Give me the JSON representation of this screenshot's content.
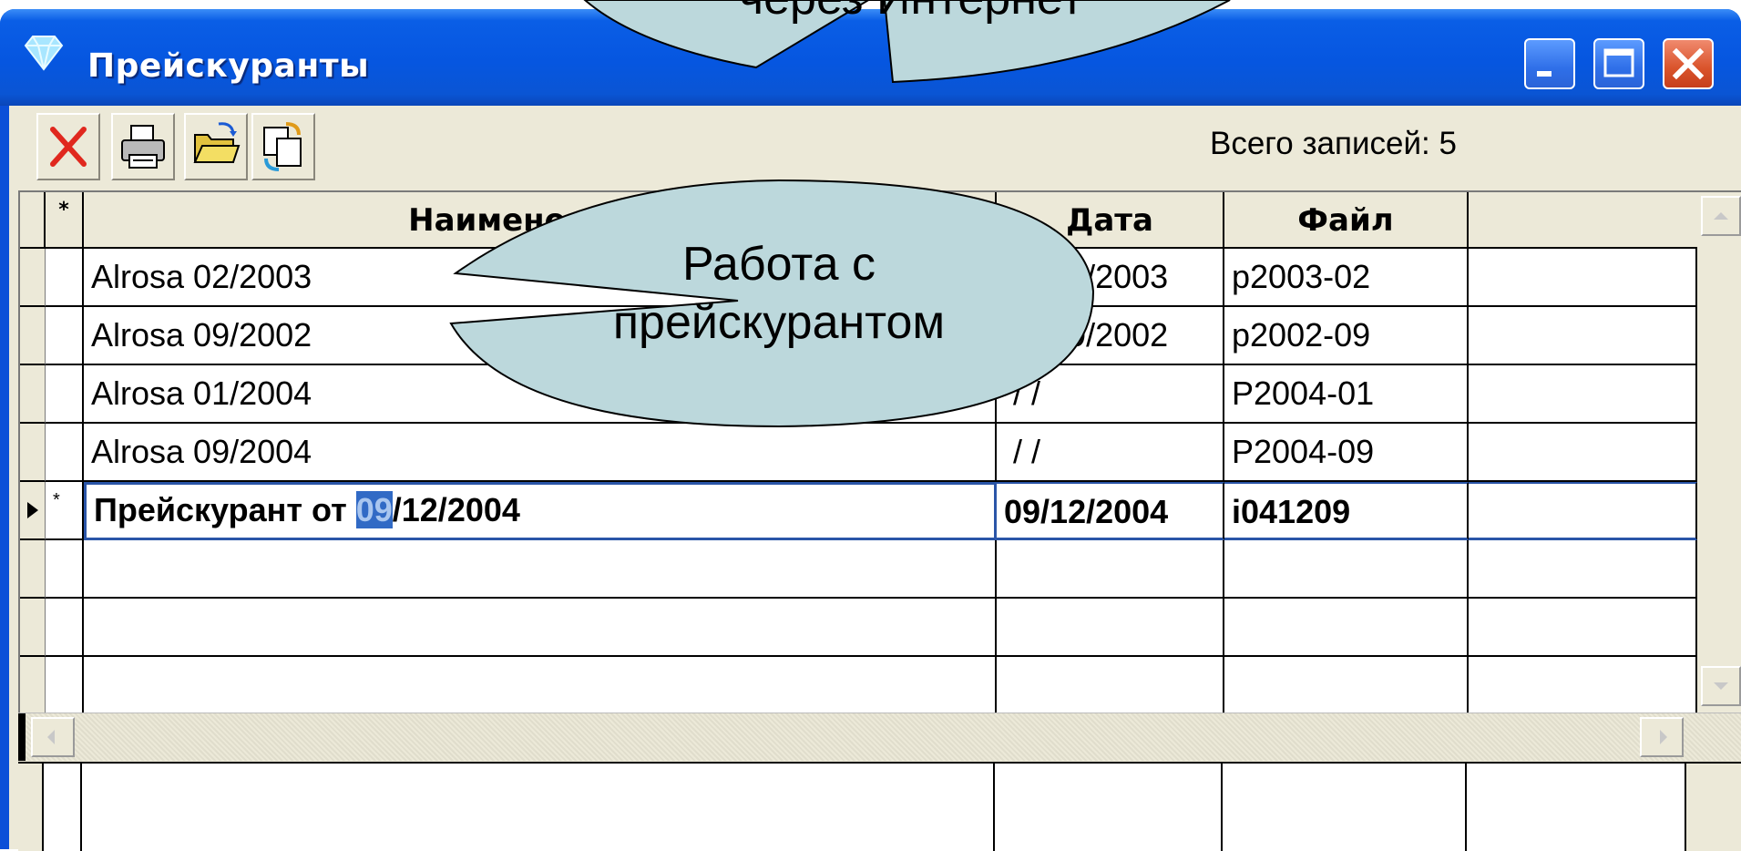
{
  "window": {
    "title": "Прейскуранты",
    "titlebar_color": "#0656e0"
  },
  "toolbar": {
    "buttons": [
      {
        "icon": "delete-icon"
      },
      {
        "icon": "print-icon"
      },
      {
        "icon": "open-folder-icon"
      },
      {
        "icon": "refresh-icon"
      }
    ],
    "record_count": "Всего записей: 5"
  },
  "grid": {
    "columns": {
      "marker": "*",
      "name": "Наименование",
      "date": "Дата",
      "file": "Файл"
    },
    "rows": [
      {
        "marker": "",
        "name": "Alrosa 02/2003",
        "date": "01/02/2003",
        "file": "p2003-02"
      },
      {
        "marker": "",
        "name": "Alrosa 09/2002",
        "date": "01/09/2002",
        "file": "p2002-09"
      },
      {
        "marker": "",
        "name": "Alrosa 01/2004",
        "date": " / /",
        "file": "P2004-01"
      },
      {
        "marker": "",
        "name": "Alrosa 09/2004",
        "date": " / /",
        "file": "P2004-09"
      }
    ],
    "current_row": {
      "marker": "*",
      "name_prefix": "Прейскурант от ",
      "name_selected": "09",
      "name_suffix": "/12/2004",
      "date": "09/12/2004",
      "file": "i041209"
    }
  },
  "callouts": {
    "top": "через Интернет",
    "middle": "Работа с прейскурантом",
    "middle_line1": "Работа с",
    "middle_line2": "прейскурантом",
    "fill_color": "#bcd8dc"
  }
}
